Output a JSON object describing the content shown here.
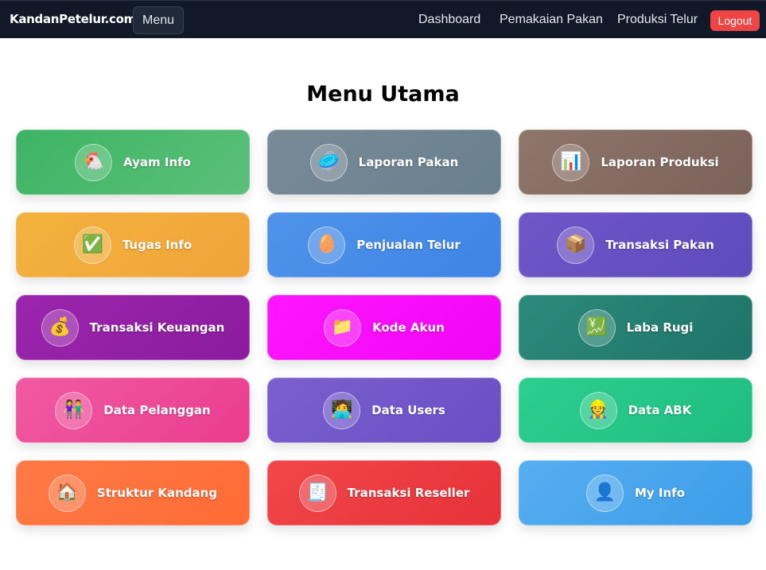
{
  "nav": {
    "brand": "KandanPetelur.com",
    "menu_label": "Menu",
    "links": [
      "Dashboard",
      "Pemakaian Pakan",
      "Produksi Telur"
    ],
    "logout_label": "Logout"
  },
  "page": {
    "title": "Menu Utama"
  },
  "menu": [
    {
      "label": "Ayam Info",
      "icon": "🐔",
      "icon_name": "chicken-icon",
      "colors": [
        "#3db463",
        "#5bc07a"
      ]
    },
    {
      "label": "Laporan Pakan",
      "icon": "🥏",
      "icon_name": "feed-icon",
      "colors": [
        "#7a8a97",
        "#68808f"
      ]
    },
    {
      "label": "Laporan Produksi",
      "icon": "📊",
      "icon_name": "bar-chart-icon",
      "colors": [
        "#8f766b",
        "#7b625a"
      ]
    },
    {
      "label": "Tugas Info",
      "icon": "✅",
      "icon_name": "checkmark-icon",
      "colors": [
        "#f3b23d",
        "#f0a43a"
      ]
    },
    {
      "label": "Penjualan Telur",
      "icon": "🥚",
      "icon_name": "egg-icon",
      "colors": [
        "#4f93ea",
        "#3d84e4"
      ]
    },
    {
      "label": "Transaksi Pakan",
      "icon": "📦",
      "icon_name": "package-icon",
      "colors": [
        "#6f56c7",
        "#5d4cbd"
      ]
    },
    {
      "label": "Transaksi Keuangan",
      "icon": "💰",
      "icon_name": "money-bag-icon",
      "colors": [
        "#9b25ad",
        "#8b1c9e"
      ]
    },
    {
      "label": "Kode Akun",
      "icon": "📁",
      "icon_name": "folder-icon",
      "colors": [
        "#ff16ff",
        "#f006f4"
      ]
    },
    {
      "label": "Laba Rugi",
      "icon": "💹",
      "icon_name": "chart-yen-icon",
      "colors": [
        "#2d8a7b",
        "#1d7468"
      ]
    },
    {
      "label": "Data Pelanggan",
      "icon": "👫",
      "icon_name": "customers-icon",
      "colors": [
        "#f15aa3",
        "#ea3c8f"
      ]
    },
    {
      "label": "Data Users",
      "icon": "🧑‍💻",
      "icon_name": "user-laptop-icon",
      "colors": [
        "#7a5fcf",
        "#6a4fc4"
      ]
    },
    {
      "label": "Data ABK",
      "icon": "👷",
      "icon_name": "worker-icon",
      "colors": [
        "#2ccf8f",
        "#1fbc80"
      ]
    },
    {
      "label": "Struktur Kandang",
      "icon": "🏠",
      "icon_name": "house-icon",
      "colors": [
        "#ff7a45",
        "#ff6b35"
      ]
    },
    {
      "label": "Transaksi Reseller",
      "icon": "🧾",
      "icon_name": "receipt-icon",
      "colors": [
        "#f0464a",
        "#e7323a"
      ]
    },
    {
      "label": "My Info",
      "icon": "👤",
      "icon_name": "person-icon",
      "colors": [
        "#57aef0",
        "#3c9de9"
      ]
    }
  ]
}
